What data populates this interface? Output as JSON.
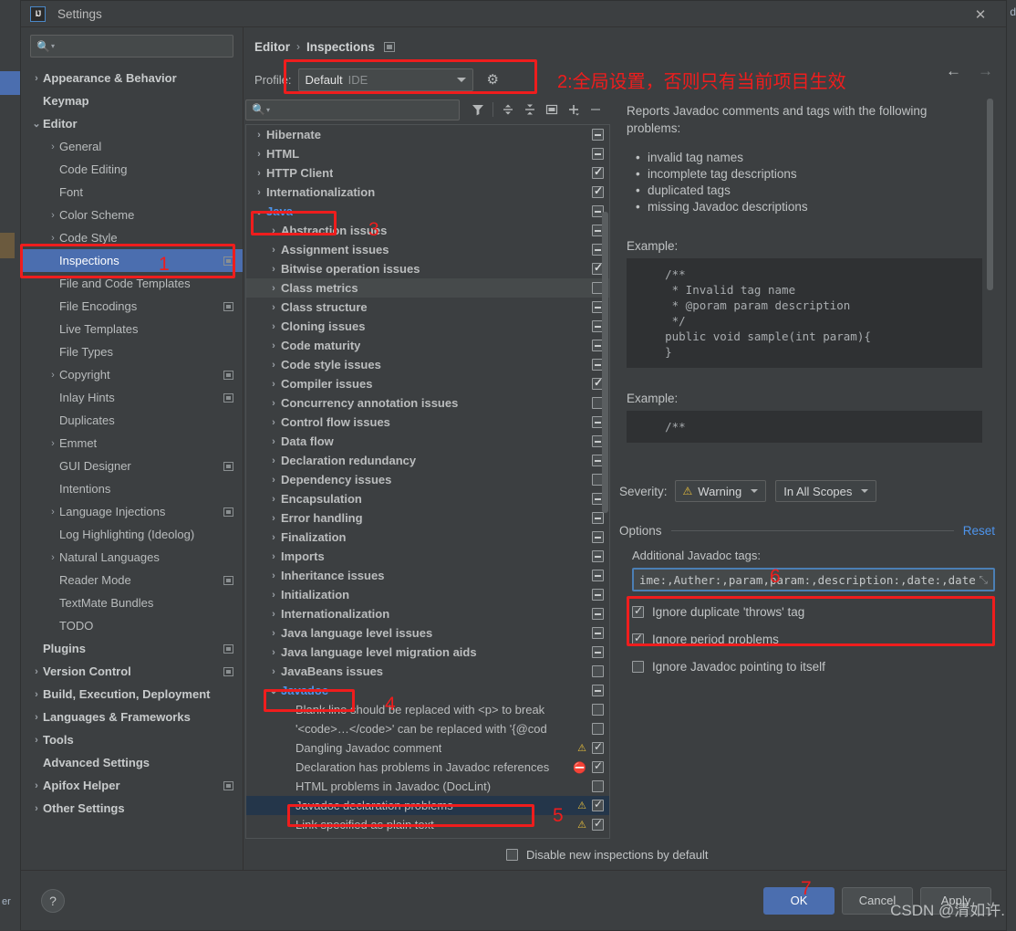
{
  "window": {
    "title": "Settings",
    "logo_text": "IJ",
    "close_icon": "✕"
  },
  "ide_background": {
    "left_label": "er"
  },
  "settings_search": {
    "placeholder": ""
  },
  "sidebar": {
    "items": [
      {
        "label": "Appearance & Behavior",
        "arrow": "›",
        "bold": true,
        "indent": 0,
        "badge": false,
        "selected": false
      },
      {
        "label": "Keymap",
        "arrow": "",
        "bold": true,
        "indent": 0,
        "badge": false,
        "selected": false
      },
      {
        "label": "Editor",
        "arrow": "⌄",
        "bold": true,
        "indent": 0,
        "badge": false,
        "selected": false
      },
      {
        "label": "General",
        "arrow": "›",
        "bold": false,
        "indent": 1,
        "badge": false,
        "selected": false
      },
      {
        "label": "Code Editing",
        "arrow": "",
        "bold": false,
        "indent": 1,
        "badge": false,
        "selected": false
      },
      {
        "label": "Font",
        "arrow": "",
        "bold": false,
        "indent": 1,
        "badge": false,
        "selected": false
      },
      {
        "label": "Color Scheme",
        "arrow": "›",
        "bold": false,
        "indent": 1,
        "badge": false,
        "selected": false
      },
      {
        "label": "Code Style",
        "arrow": "›",
        "bold": false,
        "indent": 1,
        "badge": false,
        "selected": false
      },
      {
        "label": "Inspections",
        "arrow": "",
        "bold": false,
        "indent": 1,
        "badge": true,
        "selected": true
      },
      {
        "label": "File and Code Templates",
        "arrow": "",
        "bold": false,
        "indent": 1,
        "badge": false,
        "selected": false
      },
      {
        "label": "File Encodings",
        "arrow": "",
        "bold": false,
        "indent": 1,
        "badge": true,
        "selected": false
      },
      {
        "label": "Live Templates",
        "arrow": "",
        "bold": false,
        "indent": 1,
        "badge": false,
        "selected": false
      },
      {
        "label": "File Types",
        "arrow": "",
        "bold": false,
        "indent": 1,
        "badge": false,
        "selected": false
      },
      {
        "label": "Copyright",
        "arrow": "›",
        "bold": false,
        "indent": 1,
        "badge": true,
        "selected": false
      },
      {
        "label": "Inlay Hints",
        "arrow": "",
        "bold": false,
        "indent": 1,
        "badge": true,
        "selected": false
      },
      {
        "label": "Duplicates",
        "arrow": "",
        "bold": false,
        "indent": 1,
        "badge": false,
        "selected": false
      },
      {
        "label": "Emmet",
        "arrow": "›",
        "bold": false,
        "indent": 1,
        "badge": false,
        "selected": false
      },
      {
        "label": "GUI Designer",
        "arrow": "",
        "bold": false,
        "indent": 1,
        "badge": true,
        "selected": false
      },
      {
        "label": "Intentions",
        "arrow": "",
        "bold": false,
        "indent": 1,
        "badge": false,
        "selected": false
      },
      {
        "label": "Language Injections",
        "arrow": "›",
        "bold": false,
        "indent": 1,
        "badge": true,
        "selected": false
      },
      {
        "label": "Log Highlighting (Ideolog)",
        "arrow": "",
        "bold": false,
        "indent": 1,
        "badge": false,
        "selected": false
      },
      {
        "label": "Natural Languages",
        "arrow": "›",
        "bold": false,
        "indent": 1,
        "badge": false,
        "selected": false
      },
      {
        "label": "Reader Mode",
        "arrow": "",
        "bold": false,
        "indent": 1,
        "badge": true,
        "selected": false
      },
      {
        "label": "TextMate Bundles",
        "arrow": "",
        "bold": false,
        "indent": 1,
        "badge": false,
        "selected": false
      },
      {
        "label": "TODO",
        "arrow": "",
        "bold": false,
        "indent": 1,
        "badge": false,
        "selected": false
      },
      {
        "label": "Plugins",
        "arrow": "",
        "bold": true,
        "indent": 0,
        "badge": true,
        "selected": false
      },
      {
        "label": "Version Control",
        "arrow": "›",
        "bold": true,
        "indent": 0,
        "badge": true,
        "selected": false
      },
      {
        "label": "Build, Execution, Deployment",
        "arrow": "›",
        "bold": true,
        "indent": 0,
        "badge": false,
        "selected": false
      },
      {
        "label": "Languages & Frameworks",
        "arrow": "›",
        "bold": true,
        "indent": 0,
        "badge": false,
        "selected": false
      },
      {
        "label": "Tools",
        "arrow": "›",
        "bold": true,
        "indent": 0,
        "badge": false,
        "selected": false
      },
      {
        "label": "Advanced Settings",
        "arrow": "",
        "bold": true,
        "indent": 0,
        "badge": false,
        "selected": false
      },
      {
        "label": "Apifox Helper",
        "arrow": "›",
        "bold": true,
        "indent": 0,
        "badge": true,
        "selected": false
      },
      {
        "label": "Other Settings",
        "arrow": "›",
        "bold": true,
        "indent": 0,
        "badge": false,
        "selected": false
      }
    ]
  },
  "breadcrumb": {
    "parent": "Editor",
    "separator": "›",
    "current": "Inspections"
  },
  "nav": {
    "back_icon": "←",
    "forward_icon": "→"
  },
  "profile": {
    "label": "Profile:",
    "value": "Default",
    "scope": "IDE",
    "gear_icon": "⚙"
  },
  "inspections_toolbar": {
    "search_placeholder": "",
    "icons": [
      "filter-icon",
      "expand-all-icon",
      "collapse-all-icon",
      "panel-icon",
      "add-icon",
      "remove-icon"
    ]
  },
  "inspections_tree": [
    {
      "label": "Hibernate",
      "arrow": "›",
      "indent": 0,
      "state": "dash",
      "severity": "",
      "highlight": "none",
      "blue": false,
      "bold": true
    },
    {
      "label": "HTML",
      "arrow": "›",
      "indent": 0,
      "state": "dash",
      "severity": "",
      "highlight": "none",
      "blue": false,
      "bold": true
    },
    {
      "label": "HTTP Client",
      "arrow": "›",
      "indent": 0,
      "state": "check",
      "severity": "",
      "highlight": "none",
      "blue": false,
      "bold": true
    },
    {
      "label": "Internationalization",
      "arrow": "›",
      "indent": 0,
      "state": "check",
      "severity": "",
      "highlight": "none",
      "blue": false,
      "bold": true
    },
    {
      "label": "Java",
      "arrow": "⌄",
      "indent": 0,
      "state": "dash",
      "severity": "",
      "highlight": "none",
      "blue": true,
      "bold": true
    },
    {
      "label": "Abstraction issues",
      "arrow": "›",
      "indent": 1,
      "state": "dash",
      "severity": "",
      "highlight": "none",
      "blue": false,
      "bold": true
    },
    {
      "label": "Assignment issues",
      "arrow": "›",
      "indent": 1,
      "state": "dash",
      "severity": "",
      "highlight": "none",
      "blue": false,
      "bold": true
    },
    {
      "label": "Bitwise operation issues",
      "arrow": "›",
      "indent": 1,
      "state": "check",
      "severity": "",
      "highlight": "none",
      "blue": false,
      "bold": true
    },
    {
      "label": "Class metrics",
      "arrow": "›",
      "indent": 1,
      "state": "empty",
      "severity": "",
      "highlight": "hover",
      "blue": false,
      "bold": true
    },
    {
      "label": "Class structure",
      "arrow": "›",
      "indent": 1,
      "state": "dash",
      "severity": "",
      "highlight": "none",
      "blue": false,
      "bold": true
    },
    {
      "label": "Cloning issues",
      "arrow": "›",
      "indent": 1,
      "state": "dash",
      "severity": "",
      "highlight": "none",
      "blue": false,
      "bold": true
    },
    {
      "label": "Code maturity",
      "arrow": "›",
      "indent": 1,
      "state": "dash",
      "severity": "",
      "highlight": "none",
      "blue": false,
      "bold": true
    },
    {
      "label": "Code style issues",
      "arrow": "›",
      "indent": 1,
      "state": "dash",
      "severity": "",
      "highlight": "none",
      "blue": false,
      "bold": true
    },
    {
      "label": "Compiler issues",
      "arrow": "›",
      "indent": 1,
      "state": "check",
      "severity": "",
      "highlight": "none",
      "blue": false,
      "bold": true
    },
    {
      "label": "Concurrency annotation issues",
      "arrow": "›",
      "indent": 1,
      "state": "empty",
      "severity": "",
      "highlight": "none",
      "blue": false,
      "bold": true
    },
    {
      "label": "Control flow issues",
      "arrow": "›",
      "indent": 1,
      "state": "dash",
      "severity": "",
      "highlight": "none",
      "blue": false,
      "bold": true
    },
    {
      "label": "Data flow",
      "arrow": "›",
      "indent": 1,
      "state": "dash",
      "severity": "",
      "highlight": "none",
      "blue": false,
      "bold": true
    },
    {
      "label": "Declaration redundancy",
      "arrow": "›",
      "indent": 1,
      "state": "dash",
      "severity": "",
      "highlight": "none",
      "blue": false,
      "bold": true
    },
    {
      "label": "Dependency issues",
      "arrow": "›",
      "indent": 1,
      "state": "empty",
      "severity": "",
      "highlight": "none",
      "blue": false,
      "bold": true
    },
    {
      "label": "Encapsulation",
      "arrow": "›",
      "indent": 1,
      "state": "dash",
      "severity": "",
      "highlight": "none",
      "blue": false,
      "bold": true
    },
    {
      "label": "Error handling",
      "arrow": "›",
      "indent": 1,
      "state": "dash",
      "severity": "",
      "highlight": "none",
      "blue": false,
      "bold": true
    },
    {
      "label": "Finalization",
      "arrow": "›",
      "indent": 1,
      "state": "dash",
      "severity": "",
      "highlight": "none",
      "blue": false,
      "bold": true
    },
    {
      "label": "Imports",
      "arrow": "›",
      "indent": 1,
      "state": "dash",
      "severity": "",
      "highlight": "none",
      "blue": false,
      "bold": true
    },
    {
      "label": "Inheritance issues",
      "arrow": "›",
      "indent": 1,
      "state": "dash",
      "severity": "",
      "highlight": "none",
      "blue": false,
      "bold": true
    },
    {
      "label": "Initialization",
      "arrow": "›",
      "indent": 1,
      "state": "dash",
      "severity": "",
      "highlight": "none",
      "blue": false,
      "bold": true
    },
    {
      "label": "Internationalization",
      "arrow": "›",
      "indent": 1,
      "state": "dash",
      "severity": "",
      "highlight": "none",
      "blue": false,
      "bold": true
    },
    {
      "label": "Java language level issues",
      "arrow": "›",
      "indent": 1,
      "state": "dash",
      "severity": "",
      "highlight": "none",
      "blue": false,
      "bold": true
    },
    {
      "label": "Java language level migration aids",
      "arrow": "›",
      "indent": 1,
      "state": "dash",
      "severity": "",
      "highlight": "none",
      "blue": false,
      "bold": true
    },
    {
      "label": "JavaBeans issues",
      "arrow": "›",
      "indent": 1,
      "state": "empty",
      "severity": "",
      "highlight": "none",
      "blue": false,
      "bold": true
    },
    {
      "label": "Javadoc",
      "arrow": "⌄",
      "indent": 1,
      "state": "dash",
      "severity": "",
      "highlight": "none",
      "blue": true,
      "bold": true
    },
    {
      "label": "Blank line should be replaced with <p> to break",
      "arrow": "",
      "indent": 2,
      "state": "empty",
      "severity": "",
      "highlight": "none",
      "blue": false,
      "bold": false
    },
    {
      "label": "'<code>…</code>' can be replaced with '{@cod",
      "arrow": "",
      "indent": 2,
      "state": "empty",
      "severity": "",
      "highlight": "none",
      "blue": false,
      "bold": false
    },
    {
      "label": "Dangling Javadoc comment",
      "arrow": "",
      "indent": 2,
      "state": "check",
      "severity": "warning",
      "highlight": "none",
      "blue": false,
      "bold": false
    },
    {
      "label": "Declaration has problems in Javadoc references",
      "arrow": "",
      "indent": 2,
      "state": "check",
      "severity": "error",
      "highlight": "none",
      "blue": false,
      "bold": false
    },
    {
      "label": "HTML problems in Javadoc (DocLint)",
      "arrow": "",
      "indent": 2,
      "state": "empty",
      "severity": "",
      "highlight": "none",
      "blue": false,
      "bold": false
    },
    {
      "label": "Javadoc declaration problems",
      "arrow": "",
      "indent": 2,
      "state": "check",
      "severity": "warning",
      "highlight": "selected",
      "blue": false,
      "bold": false
    },
    {
      "label": "Link specified as plain text",
      "arrow": "",
      "indent": 2,
      "state": "check",
      "severity": "warning",
      "highlight": "none",
      "blue": false,
      "bold": false
    }
  ],
  "description": {
    "intro": "Reports Javadoc comments and tags with the following problems:",
    "bullets": [
      "invalid tag names",
      "incomplete tag descriptions",
      "duplicated tags",
      "missing Javadoc descriptions"
    ],
    "example_label_1": "Example:",
    "code_1": "    /**\n     * Invalid tag name\n     * @poram param description\n     */\n    public void sample(int param){\n    }",
    "example_label_2": "Example:",
    "code_2": "    /**"
  },
  "severity": {
    "label": "Severity:",
    "value": "Warning",
    "icon": "⚠",
    "scope_value": "In All Scopes"
  },
  "options": {
    "title": "Options",
    "reset_label": "Reset",
    "tags_label": "Additional Javadoc tags:",
    "tags_value": "ime:,Auther:,param,param:,description:,date:,date",
    "expand_icon": "⤡",
    "checkboxes": [
      {
        "label": "Ignore duplicate 'throws' tag",
        "checked": true
      },
      {
        "label": "Ignore period problems",
        "checked": true
      },
      {
        "label": "Ignore Javadoc pointing to itself",
        "checked": false
      }
    ]
  },
  "footer": {
    "disable_label": "Disable new inspections by default",
    "disable_checked": false,
    "help_icon": "?",
    "ok_label": "OK",
    "cancel_label": "Cancel",
    "apply_label": "Apply"
  },
  "annotations": {
    "n1": "1",
    "n2_text": "2:全局设置，否则只有当前项目生效",
    "n3": "3",
    "n4": "4",
    "n5": "5",
    "n6": "6",
    "n7": "7"
  },
  "watermark": "CSDN @清如许.",
  "colors": {
    "accent_blue": "#4b6eaf",
    "link_blue": "#4e94ec",
    "annotation_red": "#ef1d1d",
    "warning_yellow": "#e8bf3c",
    "error_red": "#d9534f",
    "panel_bg": "#3c3f41"
  }
}
